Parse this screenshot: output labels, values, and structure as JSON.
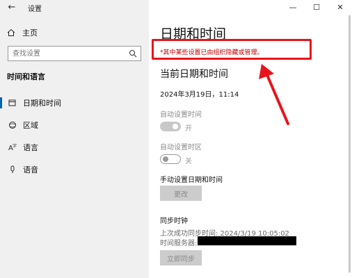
{
  "window": {
    "back_icon": "arrow-left-icon",
    "title": "设置",
    "minimize": "—",
    "maximize": "☐",
    "close": "✕"
  },
  "sidebar": {
    "home_label": "主页",
    "search_placeholder": "查找设置",
    "section_heading": "时间和语言",
    "items": [
      {
        "label": "日期和时间",
        "icon": "calendar-clock-icon",
        "selected": true
      },
      {
        "label": "区域",
        "icon": "globe-icon",
        "selected": false
      },
      {
        "label": "语言",
        "icon": "language-icon",
        "selected": false
      },
      {
        "label": "语音",
        "icon": "microphone-icon",
        "selected": false
      }
    ]
  },
  "main": {
    "title": "日期和时间",
    "policy_notice": "*其中某些设置已由组织隐藏或管理。",
    "current_heading": "当前日期和时间",
    "current_datetime": "2024年3月19日，11:14",
    "auto_time_label": "自动设置时间",
    "auto_time_state": "开",
    "auto_tz_label": "自动设置时区",
    "auto_tz_state": "关",
    "manual_label": "手动设置日期和时间",
    "change_button": "更改",
    "sync_heading": "同步时钟",
    "last_sync": "上次成功同步时间: 2024/3/19 10:05:02",
    "time_server_label": "时间服务器:",
    "sync_button": "立即同步"
  },
  "colors": {
    "annotation": "#e8141b",
    "accent": "#0063b1",
    "notice_text": "#c00000"
  }
}
